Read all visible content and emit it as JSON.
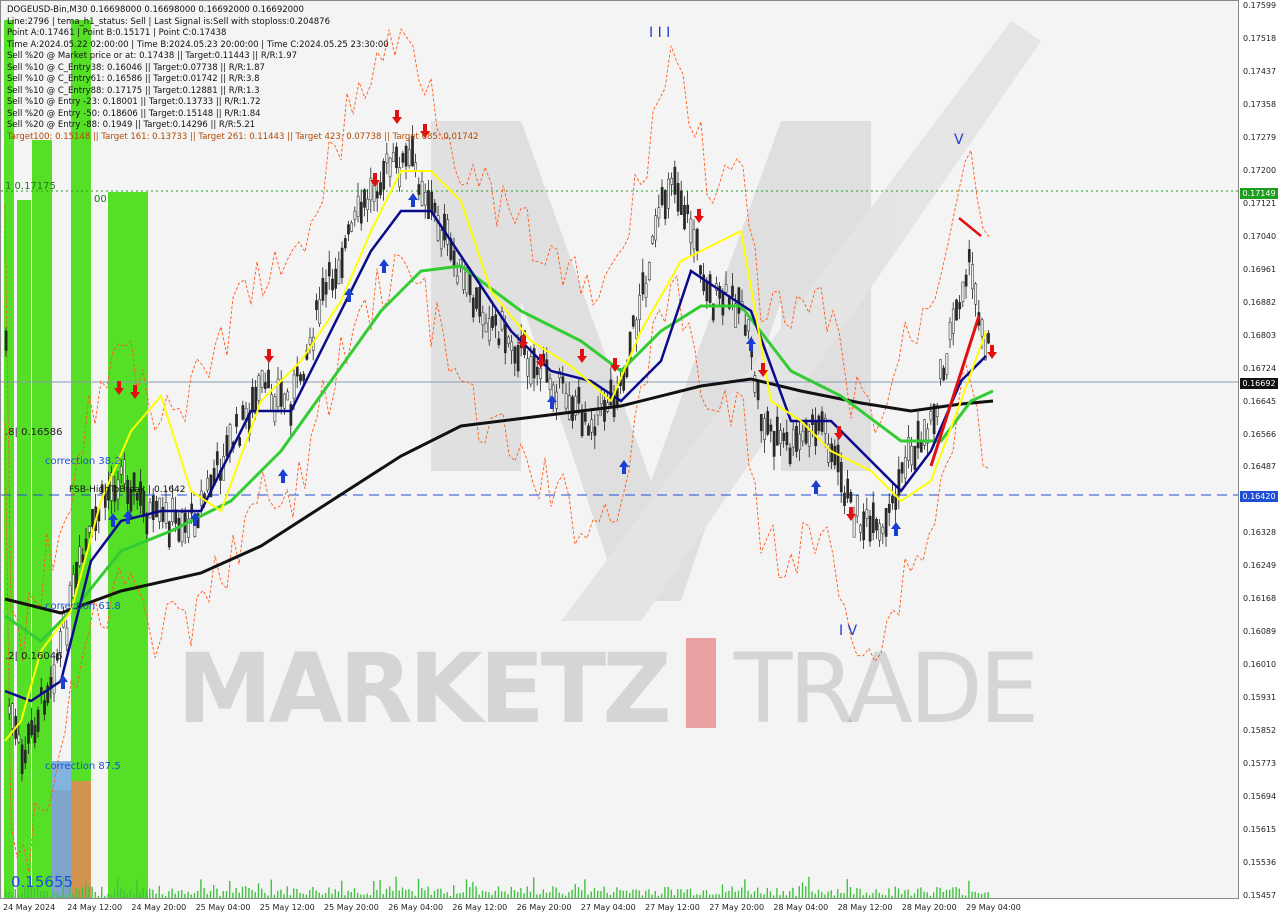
{
  "info": {
    "lines": [
      "DOGEUSD-Bin,M30  0.16698000 0.16698000 0.16692000 0.16692000",
      "Line:2796 | tema_h1_status: Sell | Last Signal is:Sell with stoploss:0.204876",
      "Point A:0.17461 | Point B:0.15171 | Point C:0.17438",
      "Time A:2024.05.22 02:00:00 | Time B:2024.05.23 20:00:00 | Time C:2024.05.25 23:30:00",
      "Sell %20 @ Market price or at: 0.17438 || Target:0.11443 || R/R:1.97",
      "Sell %10 @ C_Entry38: 0.16046 || Target:0.07738 || R/R:1.87",
      "Sell %10 @ C_Entry61: 0.16586 || Target:0.01742 || R/R:3.8",
      "Sell %10 @ C_Entry88: 0.17175 || Target:0.12881 || R/R:1.3",
      "Sell %10 @ Entry -23: 0.18001 || Target:0.13733 || R/R:1.72",
      "Sell %20 @ Entry -50: 0.18606 || Target:0.15148 || R/R:1.84",
      "Sell %20 @ Entry -88: 0.1949 || Target:0.14296 || R/R:5.21",
      "Target100: 0.15148 || Target 161: 0.13733 || Target 261: 0.11443 || Target 423: 0.07738 || Target 685: 0.01742"
    ]
  },
  "watermark": {
    "brand_left": "MARKETZ",
    "brand_right": "TRADE"
  },
  "chart_labels": {
    "level_1_0": "1 0.17175",
    "level_1_0_suffix": "00",
    "level_0_618": ".8| 0.16586",
    "level_0_236": ".2| 0.16046",
    "correction_38": "correction 38.2",
    "high_shift": "FSB-HighToBreak | 0.1642",
    "correction_61": "correction 61.8",
    "correction_87": "correction 87.5",
    "bottom_price": "0.15655",
    "wave_3": "I I I",
    "wave_4": "I V",
    "wave_5": "V"
  },
  "price_axis": {
    "labels": [
      "0.17599",
      "0.17518",
      "0.17437",
      "0.17358",
      "0.17279",
      "0.17200",
      "0.17121",
      "0.17040",
      "0.16961",
      "0.16882",
      "0.16803",
      "0.16724",
      "0.16645",
      "0.16566",
      "0.16487",
      "0.16408",
      "0.16328",
      "0.16249",
      "0.16168",
      "0.16089",
      "0.16010",
      "0.15931",
      "0.15852",
      "0.15773",
      "0.15694",
      "0.15615",
      "0.15536",
      "0.15457"
    ],
    "badge_top": "0.17149",
    "badge_current": "0.16692",
    "badge_blue": "0.16420",
    "badge_top_color": "#1e9e1e",
    "badge_current_color": "#111111",
    "badge_blue_color": "#1f4fd6"
  },
  "time_axis": {
    "labels": [
      "24 May 2024",
      "24 May 12:00",
      "24 May 20:00",
      "25 May 04:00",
      "25 May 12:00",
      "25 May 20:00",
      "26 May 04:00",
      "26 May 12:00",
      "26 May 20:00",
      "27 May 04:00",
      "27 May 12:00",
      "27 May 20:00",
      "28 May 04:00",
      "28 May 12:00",
      "28 May 20:00",
      "29 May 04:00"
    ]
  },
  "colors": {
    "tema_fast": "#ffff00",
    "tema_mid": "#0a0a8a",
    "ema_green": "#33cc33",
    "ema_long": "#111111",
    "envelope": "#ff5a1a",
    "bullish_zone": "#44dd11",
    "bearish_zone": "#e08a55",
    "sell_arrow": "#e01010",
    "buy_arrow": "#1a3fd0"
  }
}
